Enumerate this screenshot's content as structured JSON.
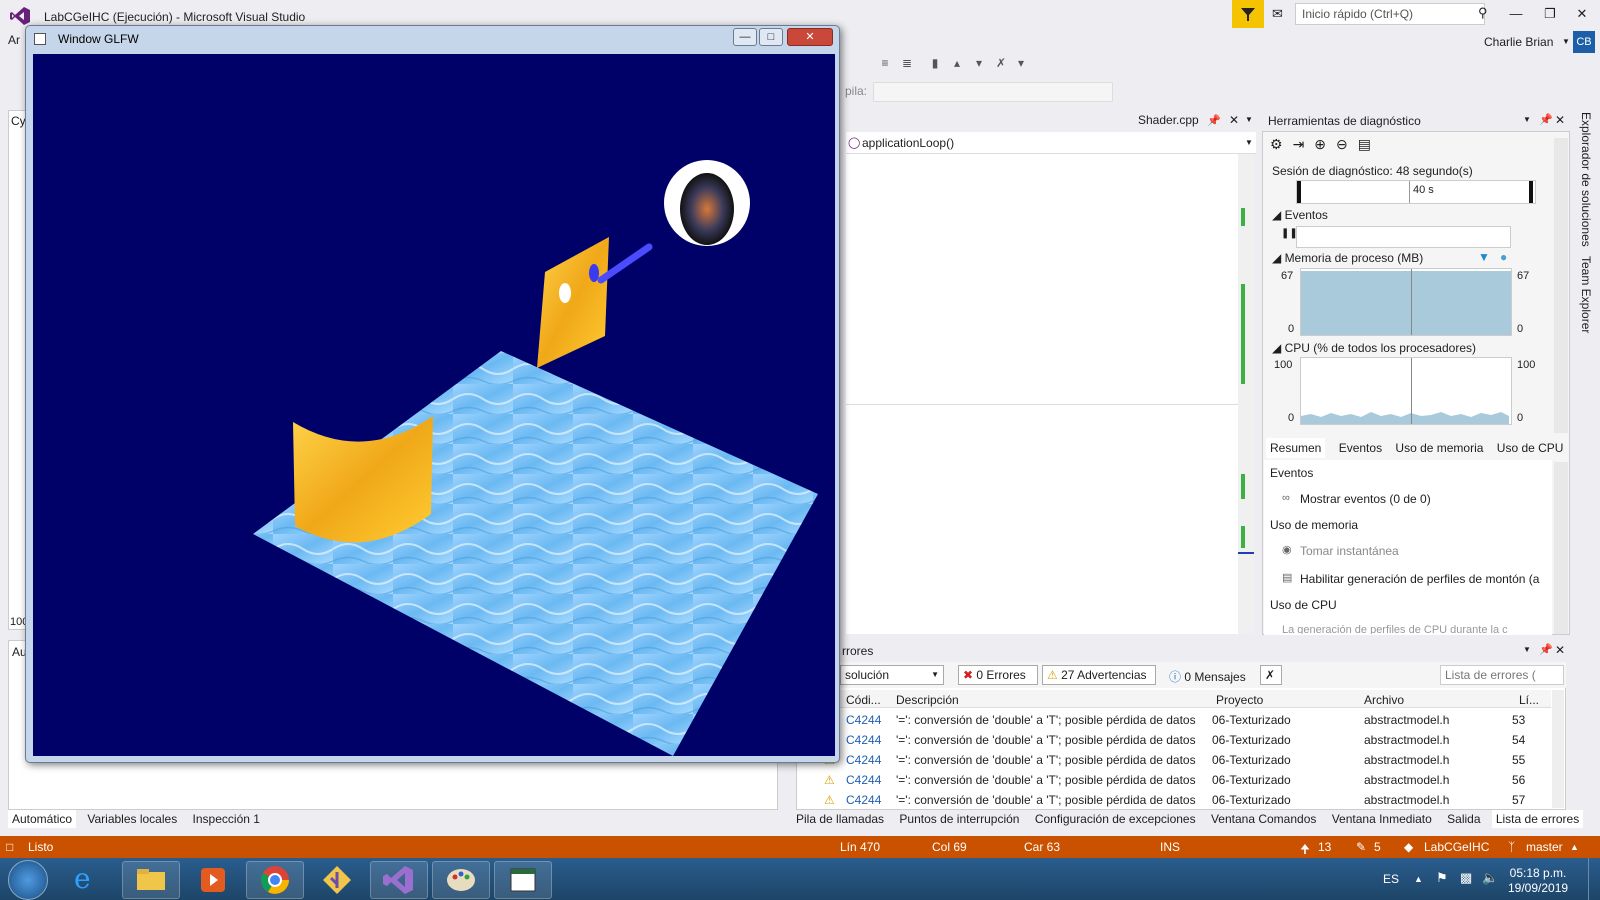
{
  "vs": {
    "title": "LabCGeIHC (Ejecución) - Microsoft Visual Studio",
    "quick_launch_placeholder": "Inicio rápido (Ctrl+Q)",
    "user_name": "Charlie Brian",
    "user_initials": "CB",
    "menubar_visible_fragment": "Ar",
    "stack_label": "pila:"
  },
  "glfw_window": {
    "title": "Window GLFW"
  },
  "editor": {
    "tab_label": "Shader.cpp",
    "nav_method": "applicationLoop()"
  },
  "left_fragments": {
    "top_tab": "Cy",
    "zoom": "100",
    "autos_fragment": "Au"
  },
  "diagnostics": {
    "header": "Herramientas de diagnóstico",
    "session": "Sesión de diagnóstico: 48 segundo(s)",
    "timeline_label": "40 s",
    "events_label": "Eventos",
    "memory_label": "Memoria de proceso (MB)",
    "memory_max": "67",
    "memory_min": "0",
    "memory_max_right": "67",
    "memory_min_right": "0",
    "cpu_label": "CPU (% de todos los procesadores)",
    "cpu_max": "100",
    "cpu_min": "0",
    "cpu_max_right": "100",
    "cpu_min_right": "0",
    "tabs": [
      "Resumen",
      "Eventos",
      "Uso de memoria",
      "Uso de CPU"
    ],
    "sections": {
      "events": "Eventos",
      "show_events": "Mostrar eventos (0 de 0)",
      "memory_usage": "Uso de memoria",
      "take_snapshot": "Tomar instantánea",
      "heap_profiling": "Habilitar generación de perfiles de montón (a",
      "cpu_usage": "Uso de CPU",
      "cpu_profiling": "La generación de perfiles de CPU durante la c"
    }
  },
  "side_tabs": [
    "Explorador de soluciones",
    "Team Explorer"
  ],
  "error_list": {
    "header_fragment": "rrores",
    "scope": "solución",
    "errors": "0 Errores",
    "warnings": "27 Advertencias",
    "messages": "0 Mensajes",
    "search_placeholder": "Lista de errores (",
    "columns": {
      "code": "Códi...",
      "description": "Descripción",
      "project": "Proyecto",
      "file": "Archivo",
      "line": "Lí..."
    },
    "rows": [
      {
        "code": "C4244",
        "description": "'=': conversión de 'double' a 'T'; posible pérdida de datos",
        "project": "06-Texturizado",
        "file": "abstractmodel.h",
        "line": "53"
      },
      {
        "code": "C4244",
        "description": "'=': conversión de 'double' a 'T'; posible pérdida de datos",
        "project": "06-Texturizado",
        "file": "abstractmodel.h",
        "line": "54"
      },
      {
        "code": "C4244",
        "description": "'=': conversión de 'double' a 'T'; posible pérdida de datos",
        "project": "06-Texturizado",
        "file": "abstractmodel.h",
        "line": "55"
      },
      {
        "code": "C4244",
        "description": "'=': conversión de 'double' a 'T'; posible pérdida de datos",
        "project": "06-Texturizado",
        "file": "abstractmodel.h",
        "line": "56"
      },
      {
        "code": "C4244",
        "description": "'=': conversión de 'double' a 'T'; posible pérdida de datos",
        "project": "06-Texturizado",
        "file": "abstractmodel.h",
        "line": "57"
      }
    ]
  },
  "bottom_tabs_left": [
    "Automático",
    "Variables locales",
    "Inspección 1"
  ],
  "bottom_tabs_right": [
    "Pila de llamadas",
    "Puntos de interrupción",
    "Configuración de excepciones",
    "Ventana Comandos",
    "Ventana Inmediato",
    "Salida",
    "Lista de errores"
  ],
  "status": {
    "ready": "Listo",
    "line": "Lín 470",
    "col": "Col 69",
    "char": "Car 63",
    "ins": "INS",
    "up_count": "13",
    "edit_count": "5",
    "repo": "LabCGeIHC",
    "branch": "master"
  },
  "taskbar": {
    "lang": "ES",
    "time": "05:18 p.m.",
    "date": "19/09/2019"
  },
  "colors": {
    "status_bar": "#ca5100",
    "scene_bg": "#000069",
    "accent": "#68217a"
  }
}
